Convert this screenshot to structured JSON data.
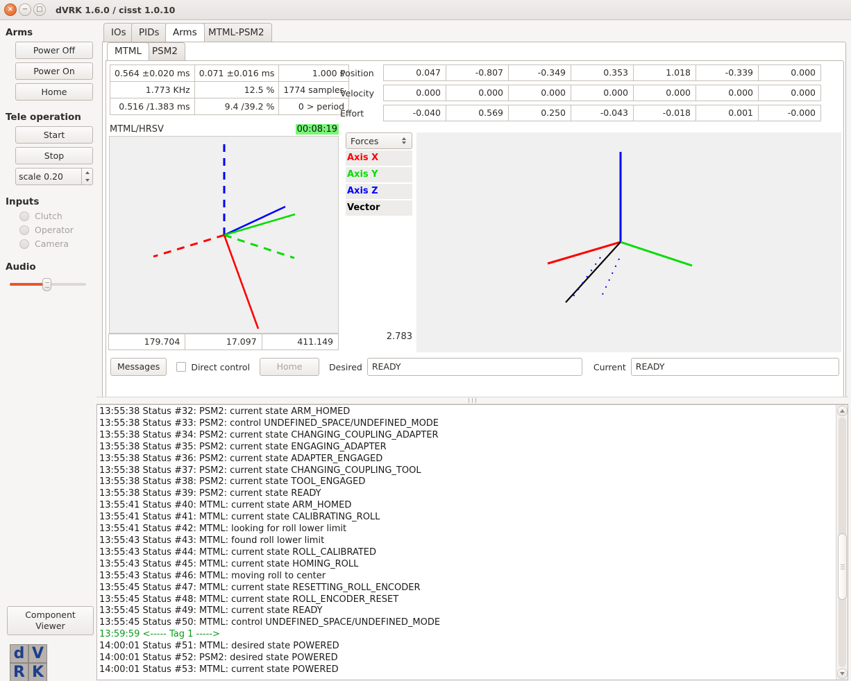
{
  "window": {
    "title": "dVRK 1.6.0 / cisst 1.0.10",
    "close_glyph": "×",
    "minimize_glyph": "−",
    "maximize_glyph": "□"
  },
  "sidebar": {
    "arms": {
      "title": "Arms",
      "buttons": [
        {
          "label": "Power Off"
        },
        {
          "label": "Power On"
        },
        {
          "label": "Home"
        }
      ]
    },
    "tele": {
      "title": "Tele operation",
      "buttons": [
        {
          "label": "Start"
        },
        {
          "label": "Stop"
        }
      ],
      "scale_value": "scale 0.20"
    },
    "inputs": {
      "title": "Inputs",
      "items": [
        {
          "label": "Clutch",
          "checked": false
        },
        {
          "label": "Operator",
          "checked": false
        },
        {
          "label": "Camera",
          "checked": false
        }
      ]
    },
    "audio": {
      "title": "Audio",
      "level_percent": 47,
      "fill_color": "#e8562a"
    },
    "component_viewer": {
      "label": "Component\nViewer",
      "line1": "Component",
      "line2": "Viewer"
    },
    "logo": {
      "letters": [
        "d",
        "V",
        "R",
        "K"
      ]
    }
  },
  "main": {
    "tabs_primary": [
      {
        "label": "IOs",
        "active": false
      },
      {
        "label": "PIDs",
        "active": false
      },
      {
        "label": "Arms",
        "active": true
      },
      {
        "label": "MTML-PSM2",
        "active": false
      }
    ],
    "tabs_secondary": [
      {
        "label": "MTML",
        "active": true
      },
      {
        "label": "PSM2",
        "active": false
      }
    ],
    "stats_table": {
      "rows": [
        [
          "0.564 ±0.020 ms",
          "0.071 ±0.016 ms",
          "1.000 s"
        ],
        [
          "1.773  KHz",
          "12.5 %",
          "1774 samples"
        ],
        [
          "0.516 /1.383 ms",
          "9.4  /39.2 %",
          "0 > period"
        ]
      ]
    },
    "joint_table": {
      "rows": [
        {
          "label": "Position",
          "values": [
            "0.047",
            "-0.807",
            "-0.349",
            "0.353",
            "1.018",
            "-0.339",
            "0.000"
          ]
        },
        {
          "label": "Velocity",
          "values": [
            "0.000",
            "0.000",
            "0.000",
            "0.000",
            "0.000",
            "0.000",
            "0.000"
          ]
        },
        {
          "label": "Effort",
          "values": [
            "-0.040",
            "0.569",
            "0.250",
            "-0.043",
            "-0.018",
            "0.001",
            "-0.000"
          ]
        }
      ]
    },
    "plot_left": {
      "name": "MTML/HRSV",
      "timer": "00:08:19",
      "timer_bg": "#77f776",
      "values": [
        "179.704",
        "17.097",
        "411.149"
      ]
    },
    "legend": {
      "selector_value": "Forces",
      "items": [
        {
          "label": "Axis X",
          "color": "#ff0000"
        },
        {
          "label": "Axis Y",
          "color": "#00dd00"
        },
        {
          "label": "Axis Z",
          "color": "#0000ff"
        },
        {
          "label": "Vector",
          "color": "#000000"
        }
      ],
      "magnitude": "2.783"
    },
    "controls": {
      "messages_label": "Messages",
      "direct_control_label": "Direct control",
      "direct_control_checked": false,
      "home_label": "Home",
      "home_disabled": true,
      "desired_label": "Desired",
      "desired_value": "READY",
      "current_label": "Current",
      "current_value": "READY"
    }
  },
  "log": {
    "lines": [
      {
        "text": "13:55:38 Status #32: PSM2: current state ARM_HOMED",
        "tag": false
      },
      {
        "text": "13:55:38 Status #33: PSM2: control UNDEFINED_SPACE/UNDEFINED_MODE",
        "tag": false
      },
      {
        "text": "13:55:38 Status #34: PSM2: current state CHANGING_COUPLING_ADAPTER",
        "tag": false
      },
      {
        "text": "13:55:38 Status #35: PSM2: current state ENGAGING_ADAPTER",
        "tag": false
      },
      {
        "text": "13:55:38 Status #36: PSM2: current state ADAPTER_ENGAGED",
        "tag": false
      },
      {
        "text": "13:55:38 Status #37: PSM2: current state CHANGING_COUPLING_TOOL",
        "tag": false
      },
      {
        "text": "13:55:38 Status #38: PSM2: current state TOOL_ENGAGED",
        "tag": false
      },
      {
        "text": "13:55:38 Status #39: PSM2: current state READY",
        "tag": false
      },
      {
        "text": "13:55:41 Status #40: MTML: current state ARM_HOMED",
        "tag": false
      },
      {
        "text": "13:55:41 Status #41: MTML: current state CALIBRATING_ROLL",
        "tag": false
      },
      {
        "text": "13:55:41 Status #42: MTML: looking for roll lower limit",
        "tag": false
      },
      {
        "text": "13:55:43 Status #43: MTML: found roll lower limit",
        "tag": false
      },
      {
        "text": "13:55:43 Status #44: MTML: current state ROLL_CALIBRATED",
        "tag": false
      },
      {
        "text": "13:55:43 Status #45: MTML: current state HOMING_ROLL",
        "tag": false
      },
      {
        "text": "13:55:43 Status #46: MTML: moving roll to center",
        "tag": false
      },
      {
        "text": "13:55:45 Status #47: MTML: current state RESETTING_ROLL_ENCODER",
        "tag": false
      },
      {
        "text": "13:55:45 Status #48: MTML: current state ROLL_ENCODER_RESET",
        "tag": false
      },
      {
        "text": "13:55:45 Status #49: MTML: current state READY",
        "tag": false
      },
      {
        "text": "13:55:45 Status #50: MTML: control UNDEFINED_SPACE/UNDEFINED_MODE",
        "tag": false
      },
      {
        "text": "13:59:59 <----- Tag 1 ----->",
        "tag": true
      },
      {
        "text": "14:00:01 Status #51: MTML: desired state POWERED",
        "tag": false
      },
      {
        "text": "14:00:01 Status #52: PSM2: desired state POWERED",
        "tag": false
      },
      {
        "text": "14:00:01 Status #53: MTML: current state POWERED",
        "tag": false
      }
    ]
  }
}
